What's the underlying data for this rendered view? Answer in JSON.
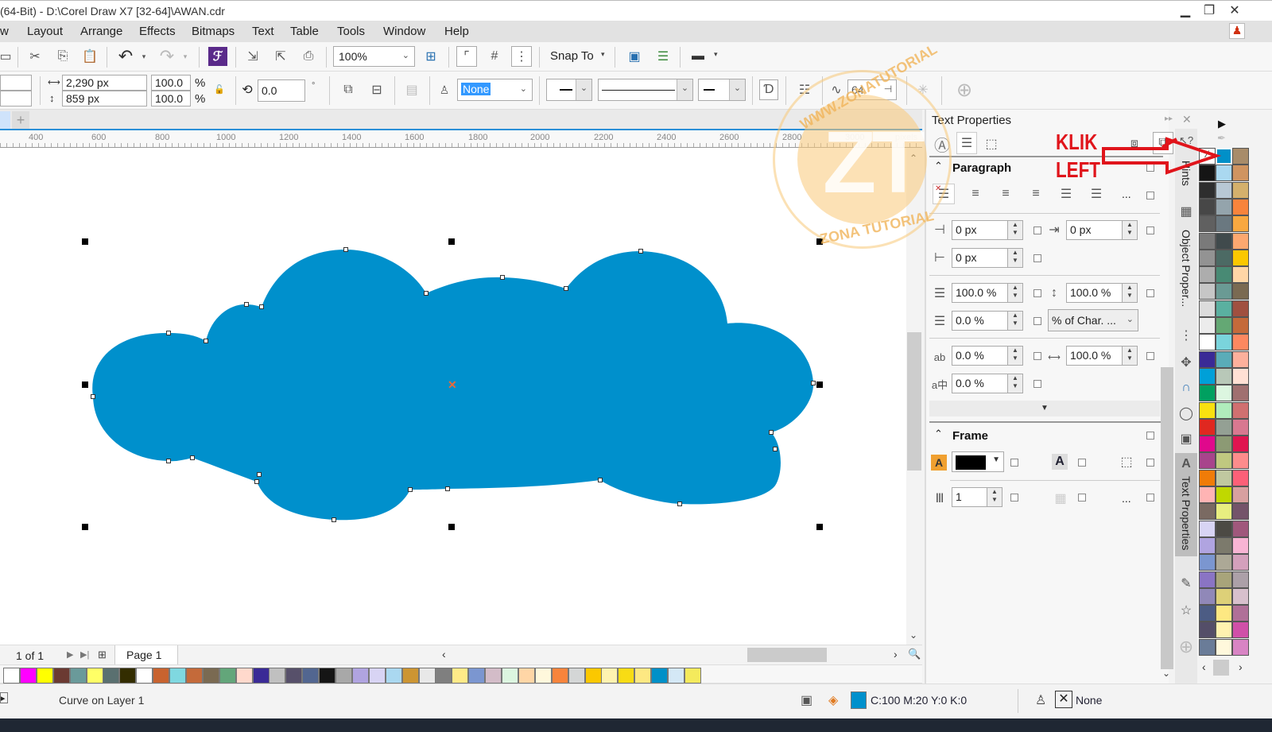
{
  "window": {
    "title": "(64-Bit) - D:\\Corel Draw X7 [32-64]\\AWAN.cdr",
    "minimize": "▁",
    "restore": "❐",
    "close": "✕"
  },
  "menu": [
    "w",
    "Layout",
    "Arrange",
    "Effects",
    "Bitmaps",
    "Text",
    "Table",
    "Tools",
    "Window",
    "Help"
  ],
  "toolbar1": {
    "zoom_value": "100%",
    "snap_to_label": "Snap To"
  },
  "toolbar2": {
    "width_value": "2,290 px",
    "height_value": "859 px",
    "scale_x": "100.0",
    "scale_y": "100.0",
    "percent": "%",
    "rotation": "0.0",
    "degree": "°",
    "outline_value": "None",
    "text_wrap_value": "64"
  },
  "ruler": {
    "ticks": [
      "400",
      "600",
      "800",
      "1000",
      "1200",
      "1400",
      "1600",
      "1800",
      "2000",
      "2200",
      "2400",
      "2600",
      "2800",
      "3000"
    ],
    "unit": "pixels"
  },
  "pagebar": {
    "page_count": "1 of 1",
    "page_tab": "Page 1"
  },
  "bottom_palette": [
    "#ffffff",
    "#ff00ff",
    "#ffff00",
    "#6b3a32",
    "#6a9a9a",
    "#ffff66",
    "#5a7070",
    "#332d00",
    "#ffffff",
    "#c8632f",
    "#7fd8e0",
    "#c46a3a",
    "#7a6a52",
    "#63a67a",
    "#ffd9cc",
    "#3a2a96",
    "#c0c0c0",
    "#57506a",
    "#526690",
    "#151515",
    "#a8a8a8",
    "#b0a4e0",
    "#d8d4f4",
    "#aad8f0",
    "#cc9533",
    "#e8e8e8",
    "#7f7f7f",
    "#ffea88",
    "#7b96d0",
    "#d3bcc8",
    "#dcf6e0",
    "#ffd6a6",
    "#fff8dc",
    "#f8843c",
    "#d4d6d6",
    "#fbc800",
    "#fff2b0",
    "#f8dc14",
    "#fde882",
    "#0090c8",
    "#d4e8f6",
    "#f4ea5c"
  ],
  "status": {
    "object_info": "Curve on Layer 1",
    "fill_color": "#0090cc",
    "fill_text": "C:100 M:20 Y:0 K:0",
    "outline_text": "None"
  },
  "docker": {
    "title": "Text Properties",
    "paragraph": {
      "title": "Paragraph",
      "left_indent": "0 px",
      "first_line_indent": "0 px",
      "right_indent": "0 px",
      "before_paragraph": "100.0 %",
      "line_spacing": "100.0 %",
      "after_paragraph": "0.0 %",
      "spacing_units": "% of Char. ...",
      "char_spacing": "0.0 %",
      "word_spacing": "100.0 %",
      "language_spacing": "0.0 %"
    },
    "frame": {
      "title": "Frame",
      "background_color": "#000000",
      "columns": "1"
    },
    "ellipsis": "..."
  },
  "vertical_tabs": [
    "Hints",
    "Object Proper...",
    "Text Properties"
  ],
  "annotation": {
    "line1": "KLIK",
    "line2": "LEFT"
  },
  "watermark": {
    "letters": "ZT",
    "top_text": "WWW.ZONATUTORIAL",
    "bottom_text": "ZONA TUTORIAL"
  },
  "right_palette": {
    "col1": [
      "#ffffff",
      "#151515",
      "#2e2e2e",
      "#474747",
      "#606060",
      "#7a7a7a",
      "#939393",
      "#adadad",
      "#c6c6c6",
      "#dcdcdc",
      "#ececec",
      "#ffffff",
      "#3a2a96",
      "#00a0d8",
      "#00a060",
      "#f8e010",
      "#e02820",
      "#e0088c",
      "#a8448c",
      "#f07c08",
      "#ffb4b4",
      "#7a6a62",
      "#d8d4f4",
      "#b0a4e0",
      "#7b96d0",
      "#8a74c4",
      "#9088b8",
      "#4c5c84",
      "#544e68",
      "#6a7c98"
    ],
    "col2": [
      "#0090c8",
      "#aad8f0",
      "#b8c8d4",
      "#94a4ac",
      "#6a7880",
      "#404a4c",
      "#4c6a64",
      "#488a74",
      "#6a9a94",
      "#5ab0a0",
      "#64a874",
      "#7ad4dc",
      "#5aacb8",
      "#b8c8b8",
      "#dcf6e0",
      "#b0ecbc",
      "#94a094",
      "#8c9a74",
      "#c0c880",
      "#c0c8a0",
      "#c0d800",
      "#e8ee80",
      "#4c4a44",
      "#7c7a6c",
      "#aca896",
      "#a8a47a",
      "#ddd078",
      "#fde882",
      "#fff2b0",
      "#fff8dc"
    ],
    "col3": [
      "#a88c6a",
      "#d09460",
      "#d4b06c",
      "#f8843c",
      "#f8a840",
      "#fca870",
      "#fbc800",
      "#ffd6a6",
      "#7a6a52",
      "#a05040",
      "#c46a3a",
      "#fc8860",
      "#fcb09c",
      "#ffe0d4",
      "#a07070",
      "#d07070",
      "#d87890",
      "#e01450",
      "#fc8c8c",
      "#fc6078",
      "#d8a0a0",
      "#74546a",
      "#a0587c",
      "#f8b4d4",
      "#d4a0bc",
      "#aca0a8",
      "#d8c0cc",
      "#b07098",
      "#d050a8",
      "#d884c4"
    ]
  }
}
